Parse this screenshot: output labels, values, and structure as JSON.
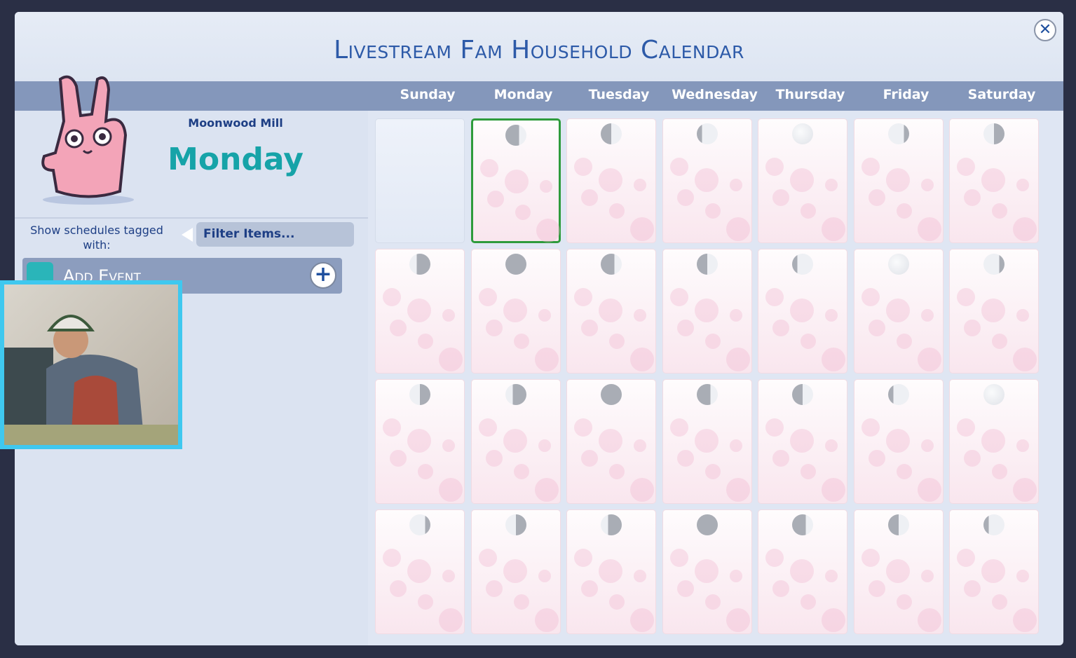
{
  "window": {
    "title": "Livestream Fam Household Calendar",
    "close_icon": "close-icon"
  },
  "days": [
    "Sunday",
    "Monday",
    "Tuesday",
    "Wednesday",
    "Thursday",
    "Friday",
    "Saturday"
  ],
  "sidebar": {
    "region": "Moonwood Mill",
    "selected_day": "Monday",
    "filter_label": "Show schedules tagged with:",
    "filter_placeholder": "Filter Items...",
    "add_event_label": "Add Event"
  },
  "colors": {
    "accent": "#16a3a8",
    "selected": "#2e9b3c",
    "header": "#8497bb"
  },
  "calendar": {
    "selected": {
      "row": 0,
      "col": 1
    },
    "weeks": [
      [
        "none",
        "waxing-crescent",
        "first-quarter",
        "waxing-gibbous",
        "full",
        "waning-gibbous",
        "third-quarter"
      ],
      [
        "waning-crescent",
        "new",
        "waxing-crescent",
        "first-quarter",
        "waxing-gibbous",
        "full",
        "waning-gibbous"
      ],
      [
        "third-quarter",
        "waning-crescent",
        "new",
        "waxing-crescent",
        "first-quarter",
        "waxing-gibbous",
        "full"
      ],
      [
        "waning-gibbous",
        "third-quarter",
        "waning-crescent",
        "new",
        "waxing-crescent",
        "first-quarter",
        "waxing-gibbous"
      ]
    ]
  }
}
